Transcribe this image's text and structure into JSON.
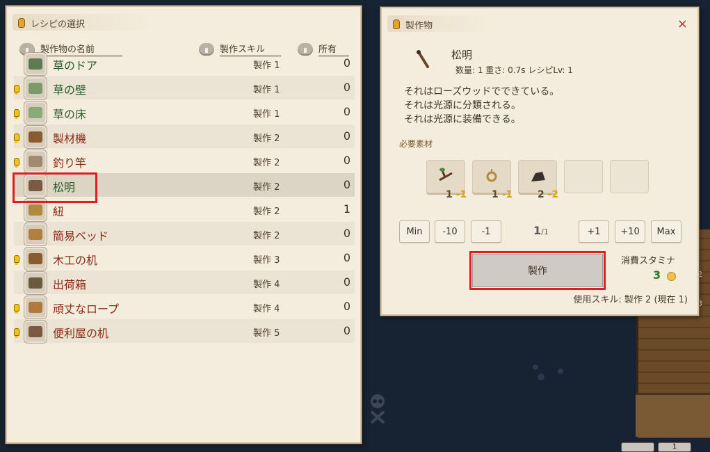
{
  "recipe_panel": {
    "title": "レシピの選択",
    "columns": {
      "name": "製作物の名前",
      "skill": "製作スキル",
      "owned": "所有"
    },
    "rows": [
      {
        "name": "草のドア",
        "skill": "製作 1",
        "owned": "0",
        "warn": false,
        "green": true,
        "icon": "grass-door-icon"
      },
      {
        "name": "草の壁",
        "skill": "製作 1",
        "owned": "0",
        "warn": true,
        "green": true,
        "icon": "grass-wall-icon"
      },
      {
        "name": "草の床",
        "skill": "製作 1",
        "owned": "0",
        "warn": true,
        "green": true,
        "icon": "grass-floor-icon"
      },
      {
        "name": "製材機",
        "skill": "製作 2",
        "owned": "0",
        "warn": true,
        "green": false,
        "icon": "sawmill-icon"
      },
      {
        "name": "釣り竿",
        "skill": "製作 2",
        "owned": "0",
        "warn": true,
        "green": false,
        "icon": "fishing-rod-icon"
      },
      {
        "name": "松明",
        "skill": "製作 2",
        "owned": "0",
        "warn": false,
        "green": true,
        "icon": "torch-icon",
        "selected": true
      },
      {
        "name": "紐",
        "skill": "製作 2",
        "owned": "1",
        "warn": false,
        "green": false,
        "icon": "rope-icon"
      },
      {
        "name": "簡易ベッド",
        "skill": "製作 2",
        "owned": "0",
        "warn": false,
        "green": false,
        "icon": "simple-bed-icon"
      },
      {
        "name": "木工の机",
        "skill": "製作 3",
        "owned": "0",
        "warn": true,
        "green": false,
        "icon": "woodwork-desk-icon"
      },
      {
        "name": "出荷箱",
        "skill": "製作 4",
        "owned": "0",
        "warn": false,
        "green": false,
        "icon": "shipping-box-icon"
      },
      {
        "name": "頑丈なロープ",
        "skill": "製作 4",
        "owned": "0",
        "warn": true,
        "green": false,
        "icon": "sturdy-rope-icon"
      },
      {
        "name": "便利屋の机",
        "skill": "製作 5",
        "owned": "0",
        "warn": true,
        "green": false,
        "icon": "handyman-desk-icon"
      }
    ]
  },
  "craft_panel": {
    "title": "製作物",
    "close": "×",
    "item_name": "松明",
    "meta": "数量: 1  重さ: 0.7s  レシピLv: 1",
    "desc": [
      "それはローズウッドでできている。",
      "それは光源に分類される。",
      "それは光源に装備できる。"
    ],
    "materials_label": "必要素材",
    "materials": [
      {
        "icon": "branch-icon",
        "have": "1",
        "need": "-1"
      },
      {
        "icon": "rope-icon",
        "have": "1",
        "need": "-1"
      },
      {
        "icon": "ore-icon",
        "have": "2",
        "need": "-2"
      }
    ],
    "buttons": {
      "min": "Min",
      "minus10": "-10",
      "minus1": "-1",
      "plus1": "+1",
      "plus10": "+10",
      "max": "Max"
    },
    "quantity": "1",
    "quantity_max": "/1",
    "craft_label": "製作",
    "stamina_label": "消費スタミナ",
    "stamina_value": "3",
    "skill_use": "使用スキル: 製作 2 (現在 1)"
  },
  "side_numbers": [
    "2",
    "3"
  ],
  "bottom_slot": "1"
}
